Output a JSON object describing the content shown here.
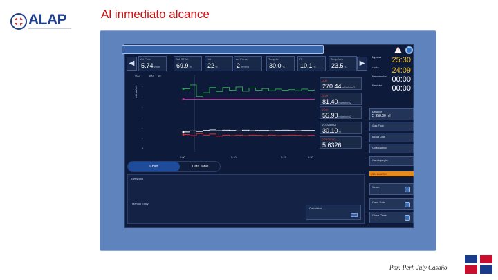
{
  "slide": {
    "logo_text": "ALAP",
    "title": "Al inmediato alcance",
    "footer": "Por: Perf. July Casaño"
  },
  "params": [
    {
      "label": "Art Flow",
      "value": "5.74",
      "unit": "l/min"
    },
    {
      "label": "Sat O2 Art",
      "value": "69.9",
      "unit": "%"
    },
    {
      "label": "Hct",
      "value": "22",
      "unit": "%"
    },
    {
      "label": "Art Press",
      "value": "2",
      "unit": "mmHg"
    },
    {
      "label": "Temp Art",
      "value": "30.0",
      "unit": "°C"
    },
    {
      "label": "IT",
      "value": "10.1",
      "unit": "°C"
    },
    {
      "label": "Temp Ven",
      "value": "23.5",
      "unit": "°C"
    }
  ],
  "timers": [
    {
      "label": "Bypass",
      "sub": "25:30",
      "value": "25:30",
      "color": "#f2c21a"
    },
    {
      "label": "Aorta",
      "sub": "24:09",
      "value": "24:09",
      "color": "#f2c21a"
    },
    {
      "label": "Reperfusion",
      "sub": "00:00",
      "value": "00:00",
      "color": "#ffffff"
    },
    {
      "label": "Resistor",
      "sub": "00:00",
      "value": "00:00",
      "color": "#ffffff"
    }
  ],
  "chart": {
    "y_ticks": [
      "400",
      "100",
      "10",
      "-",
      "-",
      "-",
      "-",
      "-",
      "-",
      "0"
    ],
    "unit_label": "ml/min/m2",
    "x_ticks": [
      "0:00",
      "0:10",
      "0:15",
      "0:20"
    ]
  },
  "chart_data": {
    "type": "line",
    "x": [
      0,
      1,
      2,
      3,
      4,
      5,
      6,
      7,
      8,
      9,
      10,
      11,
      12,
      13,
      14,
      15,
      16,
      17,
      18,
      19,
      20
    ],
    "series": [
      {
        "name": "DO2",
        "color": "#2fb34a",
        "values": [
          245,
          260,
          215,
          230,
          250,
          235,
          250,
          240,
          252,
          236,
          248,
          240,
          246,
          238,
          244,
          240,
          242,
          238,
          244,
          240,
          242
        ]
      },
      {
        "name": "VO2",
        "color": "#c63aa4",
        "values": [
          205,
          205,
          205,
          205,
          205,
          205,
          205,
          205,
          205,
          205,
          205,
          205,
          205,
          205,
          205,
          205,
          205,
          205,
          205,
          205,
          205
        ]
      },
      {
        "name": "VCO2",
        "color": "#ffffff",
        "values": [
          78,
          82,
          80,
          84,
          86,
          83,
          85,
          84,
          82,
          85,
          83,
          84,
          84,
          83,
          84,
          85,
          84,
          83,
          84,
          84,
          84
        ]
      },
      {
        "name": "DO2/VCO2",
        "color": "#e33333",
        "values": [
          68,
          64,
          72,
          66,
          70,
          62,
          66,
          64,
          66,
          64,
          66,
          65,
          64,
          66,
          64,
          65,
          66,
          65,
          64,
          65,
          65
        ]
      }
    ],
    "ylim": [
      0,
      300
    ]
  },
  "cards": [
    {
      "label": "DO2",
      "value": "270.44",
      "unit": "ml/min/m2",
      "color": "#e14b4b"
    },
    {
      "label": "DO2i",
      "value": "81.40",
      "unit": "ml/min/m2",
      "color": "#e14b4b"
    },
    {
      "label": "VO2i",
      "value": "55.90",
      "unit": "ml/min/m2",
      "color": "#e14b4b"
    },
    {
      "label": "VCO2/DO2i",
      "value": "30.10",
      "unit": "%",
      "color": "#d2dbef"
    },
    {
      "label": "DO2/VCO2",
      "value": "5.6326",
      "unit": "",
      "color": "#e14b4b"
    }
  ],
  "tabs": [
    {
      "label": "Chart"
    },
    {
      "label": "Data Table"
    }
  ],
  "notes": {
    "title": "Threshold",
    "body": "Manual Entry",
    "calc_label": "Calculator"
  },
  "right_panel": [
    {
      "label": "Balance",
      "value": "Σ 958.00 ml",
      "top": 156
    },
    {
      "label": "Gas Flow",
      "value": "",
      "top": 176
    },
    {
      "label": "Blood Gas",
      "value": "",
      "top": 192
    },
    {
      "label": "Coagulation",
      "value": "",
      "top": 208
    },
    {
      "label": "Cardioplegia",
      "value": "",
      "top": 226
    }
  ],
  "alarm": "CDI ALARM",
  "right_actions": [
    {
      "label": "Setup",
      "top": 265
    },
    {
      "label": "Case Data",
      "top": 287
    },
    {
      "label": "Close Case",
      "top": 306
    }
  ]
}
